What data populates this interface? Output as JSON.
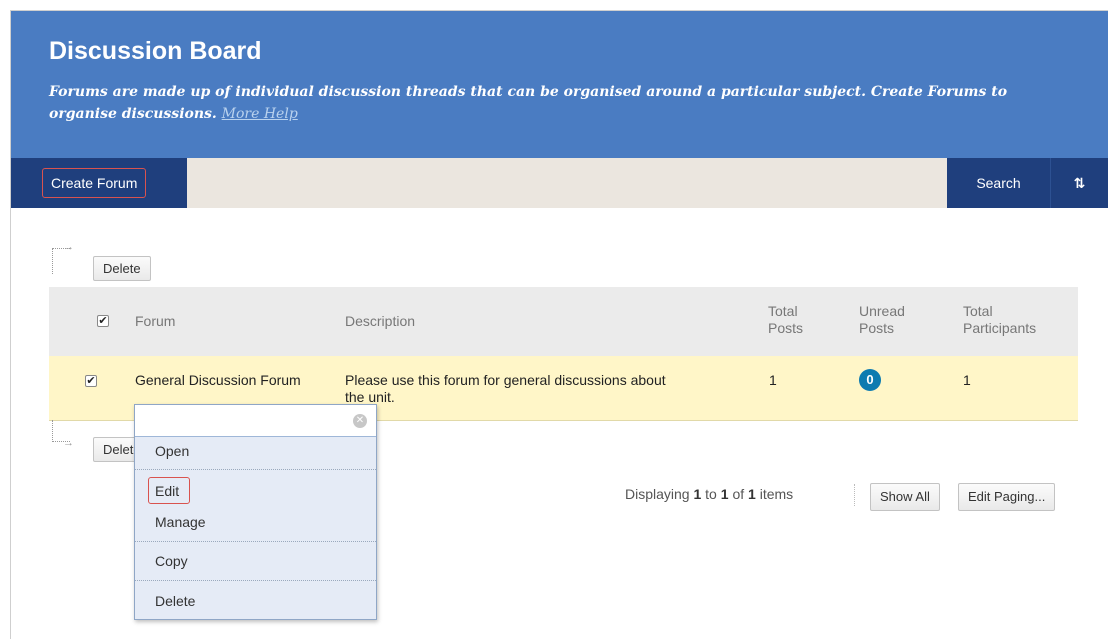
{
  "header": {
    "title": "Discussion Board",
    "description": "Forums are made up of individual discussion threads that can be organised around a particular subject. Create Forums to organise discussions.",
    "help_link": "More Help"
  },
  "toolbar": {
    "create_label": "Create Forum",
    "search_label": "Search",
    "sort_icon_glyph": "⇅"
  },
  "actions": {
    "delete_top": "Delete",
    "delete_bottom": "Delete"
  },
  "table": {
    "columns": {
      "forum": "Forum",
      "description": "Description",
      "total_posts_1": "Total",
      "total_posts_2": "Posts",
      "unread_posts_1": "Unread",
      "unread_posts_2": "Posts",
      "total_participants_1": "Total",
      "total_participants_2": "Participants"
    },
    "rows": [
      {
        "forum": "General Discussion Forum",
        "description_line1": "Please use this forum for general discussions about",
        "description_line2": "the unit.",
        "total_posts": "1",
        "unread_posts": "0",
        "total_participants": "1"
      }
    ]
  },
  "paging": {
    "prefix": "Displaying",
    "from": "1",
    "to_word": "to",
    "to": "1",
    "of_word": "of",
    "total": "1",
    "suffix": "items",
    "show_all": "Show All",
    "edit_paging": "Edit Paging..."
  },
  "context_menu": {
    "items": [
      "Open",
      "Edit",
      "Manage",
      "Copy",
      "Delete"
    ]
  },
  "colors": {
    "header_bg": "#4a7cc2",
    "toolbar_dark": "#1f3f7d",
    "highlight_row": "#fff6c8",
    "badge": "#0d7bb0",
    "focus_outline": "#d9534f"
  }
}
